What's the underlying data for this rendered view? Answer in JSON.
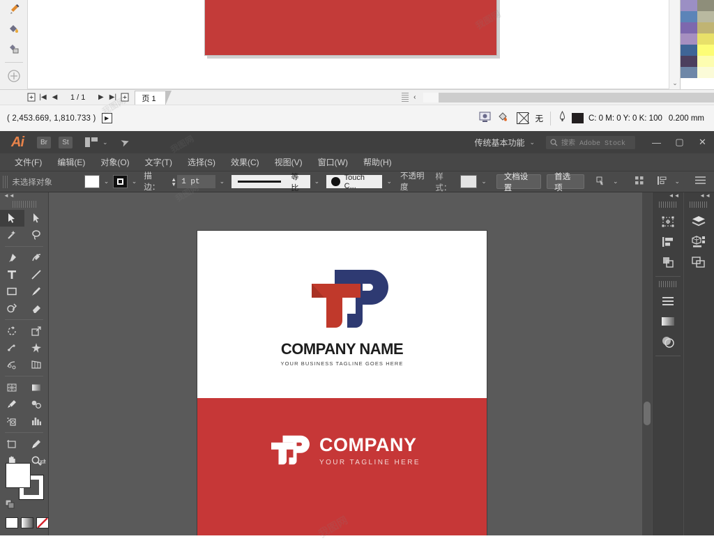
{
  "background_app": {
    "page_nav": {
      "add_page_left": "add-page",
      "first": "|◀",
      "prev": "◀",
      "page_indicator": "1 / 1",
      "next": "▶",
      "last": "▶|",
      "add_page_right": "add-page",
      "tab_label": "页 1"
    },
    "status": {
      "coordinates": "( 2,453.669, 1,810.733 )",
      "fill_none_label": "无",
      "outline_color_cmyk": "C: 0 M: 0 Y: 0 K: 100",
      "outline_width": "0.200 mm"
    },
    "palette_colors": [
      "#9b8fc4",
      "#8e8e7a",
      "#5c84b8",
      "#b9b9a0",
      "#7d68ae",
      "#c0b473",
      "#a68fc0",
      "#e8e069",
      "#3f6596",
      "#fdfd76",
      "#4c3f5e",
      "#fdfdb0",
      "#6e87a8",
      "#fbfbd8"
    ],
    "palette_nav": {
      "prev": "‹",
      "next": "›"
    }
  },
  "illustrator": {
    "title_bar": {
      "app_logo": "Ai",
      "bridge": "Br",
      "stock": "St",
      "workspace": "传统基本功能",
      "search_placeholder": "搜索 Adobe Stock",
      "minimize": "—",
      "maximize": "▢",
      "close": "✕"
    },
    "menus": [
      "文件(F)",
      "编辑(E)",
      "对象(O)",
      "文字(T)",
      "选择(S)",
      "效果(C)",
      "视图(V)",
      "窗口(W)",
      "帮助(H)"
    ],
    "control_bar": {
      "selection_status": "未选择对象",
      "stroke_label": "描边：",
      "stroke_weight": "1 pt",
      "stroke_profile": "等比",
      "brush_definition": "Touch C...",
      "opacity_label": "不透明度",
      "style_label": "样式：",
      "document_setup": "文档设置",
      "preferences": "首选项"
    },
    "tools": [
      "selection-tool",
      "direct-selection-tool",
      "magic-wand-tool",
      "lasso-tool",
      "pen-tool",
      "curvature-tool",
      "type-tool",
      "line-segment-tool",
      "rectangle-tool",
      "paintbrush-tool",
      "shaper-tool",
      "eraser-tool",
      "rotate-tool",
      "scale-tool",
      "width-tool",
      "free-transform-tool",
      "shape-builder-tool",
      "perspective-grid-tool",
      "mesh-tool",
      "gradient-tool",
      "eyedropper-tool",
      "blend-tool",
      "symbol-sprayer-tool",
      "column-graph-tool",
      "artboard-tool",
      "slice-tool",
      "hand-tool",
      "zoom-tool"
    ],
    "color_controls": {
      "fill": "#ffffff",
      "stroke": "#ffffff",
      "swap": "swap-fill-stroke",
      "default": "default-fill-stroke",
      "modes": [
        "color",
        "gradient",
        "none"
      ]
    },
    "right_panels_col1": [
      "transform-panel",
      "align-panel",
      "pathfinder-panel",
      "properties-panel",
      "appearance-panel",
      "transparency-panel"
    ],
    "right_panels_col2": [
      "layers-panel",
      "libraries-panel",
      "artboards-panel"
    ],
    "canvas": {
      "logo_top": {
        "company_name": "COMPANY NAME",
        "tagline": "YOUR BUSINESS TAGLINE GOES HERE"
      },
      "logo_bottom": {
        "company_name": "COMPANY",
        "tagline": "YOUR TAGLINE HERE"
      },
      "colors": {
        "red": "#c63737",
        "navy": "#2e3a72",
        "brick": "#c0392b",
        "white": "#ffffff"
      }
    }
  },
  "watermark": "我图网"
}
